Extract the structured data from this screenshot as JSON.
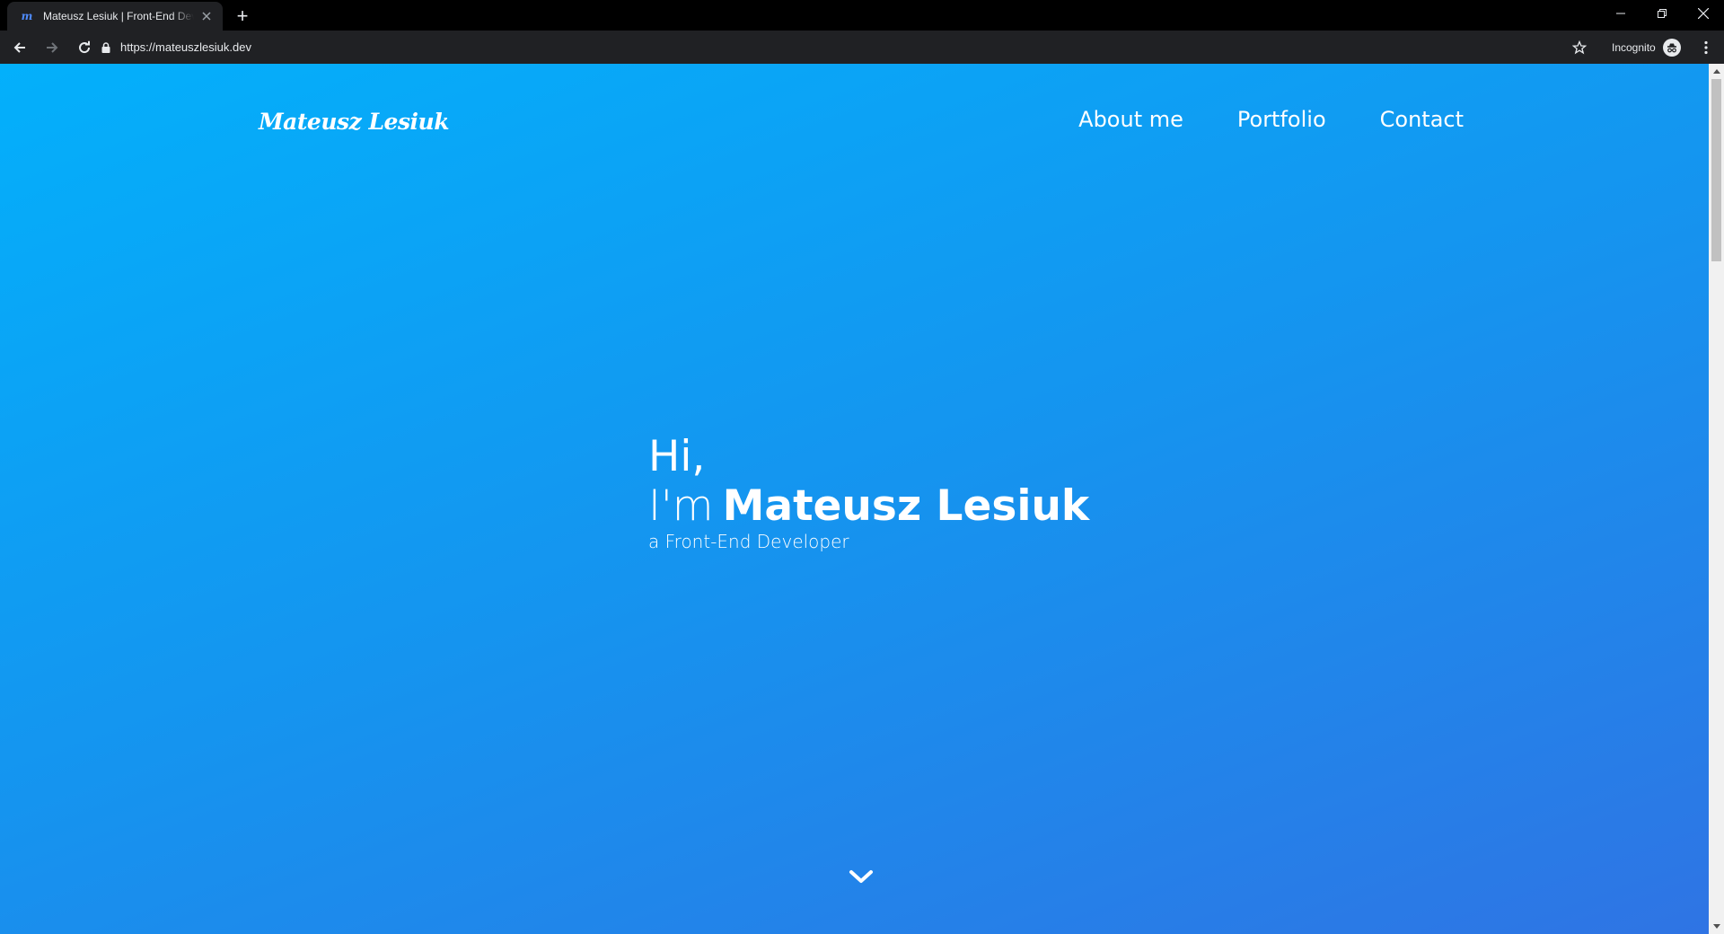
{
  "browser": {
    "tab": {
      "favicon": "m",
      "title": "Mateusz Lesiuk | Front-End Developer",
      "close_icon": "close-icon"
    },
    "new_tab_label": "+",
    "url": "https://mateuszlesiuk.dev",
    "incognito_label": "Incognito",
    "icons": [
      "back-arrow-icon",
      "forward-arrow-icon",
      "reload-icon",
      "lock-icon",
      "star-icon",
      "incognito-icon",
      "kebab-menu-icon",
      "minimize-icon",
      "restore-icon",
      "close-window-icon"
    ]
  },
  "site": {
    "logo": "Mateusz Lesiuk",
    "nav": [
      {
        "label": "About me"
      },
      {
        "label": "Portfolio"
      },
      {
        "label": "Contact"
      }
    ],
    "hero": {
      "hi": "Hi,",
      "im": "I'm",
      "name": "Mateusz Lesiuk",
      "role": "a Front-End Developer",
      "scroll_icon": "chevron-down-icon"
    },
    "colors": {
      "gradient_start": "#03b0fb",
      "gradient_mid": "#1594ef",
      "gradient_end": "#2f74e4",
      "text": "#ffffff"
    }
  }
}
